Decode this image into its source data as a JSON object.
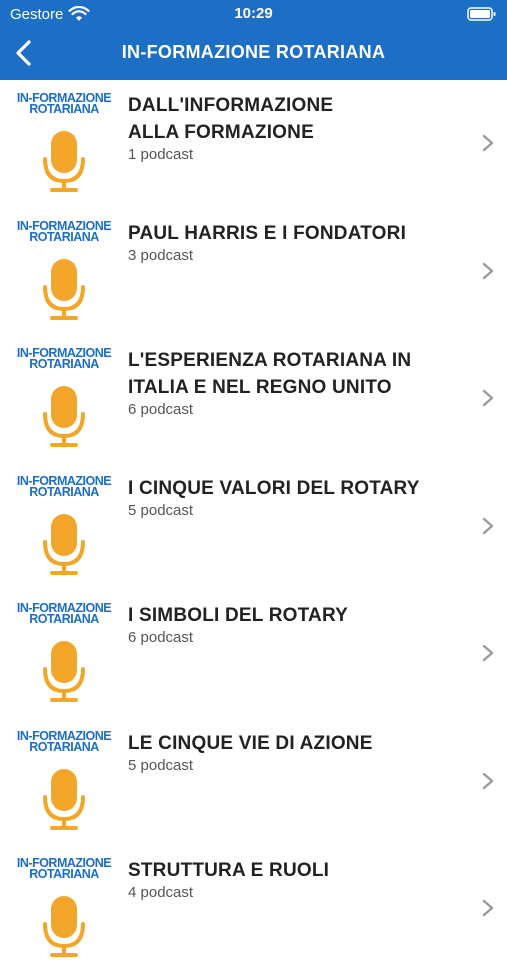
{
  "status": {
    "carrier": "Gestore",
    "time": "10:29"
  },
  "nav": {
    "title": "IN-FORMAZIONE ROTARIANA"
  },
  "logo": {
    "line1": "IN-FORMAZIONE",
    "line2": "ROTARIANA"
  },
  "colors": {
    "bar": "#1d6fc6",
    "mic": "#f3a72a"
  },
  "items": [
    {
      "title_line1": "DALL'INFORMAZIONE",
      "title_line2": "ALLA FORMAZIONE",
      "count": "1 podcast"
    },
    {
      "title_line1": "PAUL HARRIS E I FONDATORI",
      "title_line2": "",
      "count": "3 podcast"
    },
    {
      "title_line1": "L'ESPERIENZA ROTARIANA IN",
      "title_line2": "ITALIA E NEL REGNO UNITO",
      "count": "6 podcast"
    },
    {
      "title_line1": "I CINQUE VALORI DEL ROTARY",
      "title_line2": "",
      "count": "5 podcast"
    },
    {
      "title_line1": "I SIMBOLI DEL ROTARY",
      "title_line2": "",
      "count": "6 podcast"
    },
    {
      "title_line1": "LE CINQUE VIE DI AZIONE",
      "title_line2": "",
      "count": "5 podcast"
    },
    {
      "title_line1": "STRUTTURA E RUOLI",
      "title_line2": "",
      "count": "4 podcast"
    }
  ]
}
